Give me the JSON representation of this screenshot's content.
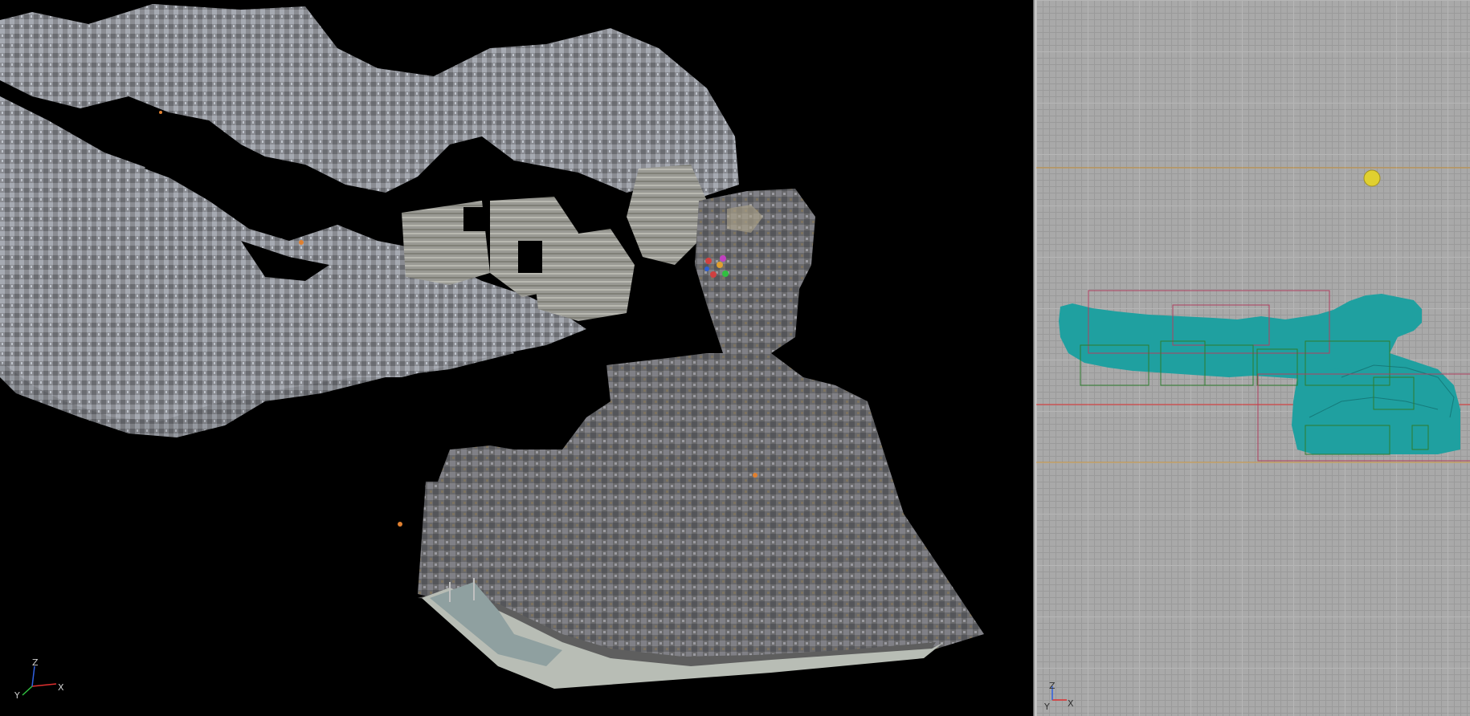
{
  "viewports": {
    "perspective": {
      "axes": {
        "x_label": "X",
        "y_label": "Y",
        "z_label": "Z"
      }
    },
    "orthographic": {
      "axes": {
        "x_label": "X",
        "y_label": "Y",
        "z_label": "Z"
      }
    }
  },
  "colors": {
    "background_3d": "#000000",
    "grid_background": "#a9a9a9",
    "wireframe_teal": "#1fa0a0",
    "bbox_green": "#2e7d2e",
    "bbox_red": "#b04060",
    "horizon_orange": "#c8913a",
    "axis_red": "#e03030",
    "light_yellow": "#e0d030"
  }
}
